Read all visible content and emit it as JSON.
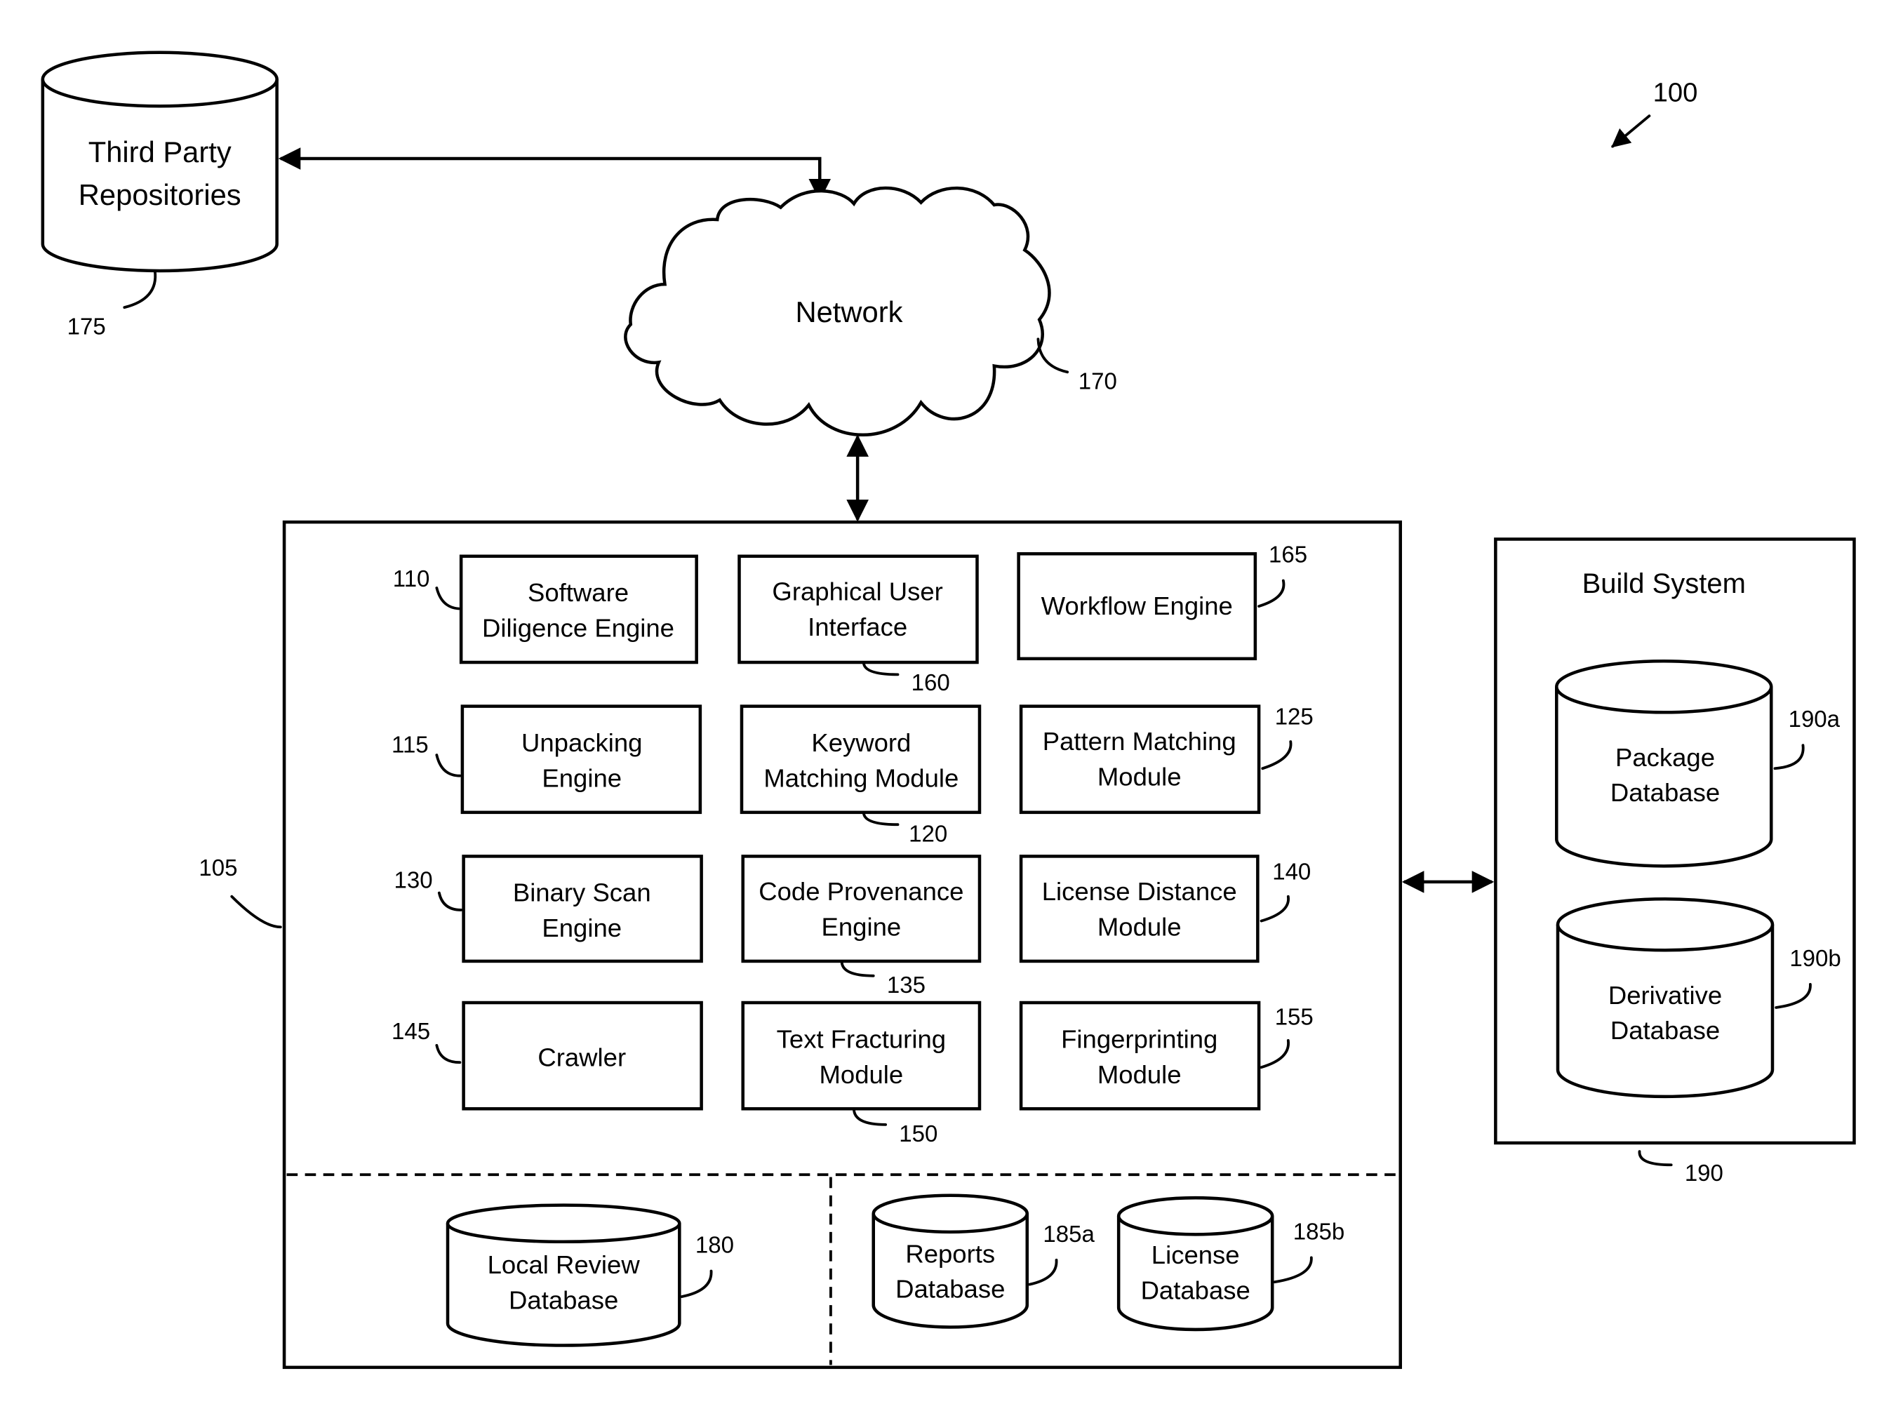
{
  "figure_ref": "100",
  "third_party": {
    "lines": [
      "Third Party",
      "Repositories"
    ],
    "ref": "175"
  },
  "network": {
    "label": "Network",
    "ref": "170"
  },
  "system": {
    "ref": "105",
    "modules": [
      {
        "lines": [
          "Software",
          "Diligence Engine"
        ],
        "ref": "110"
      },
      {
        "lines": [
          "Graphical User",
          "Interface"
        ],
        "ref": "160"
      },
      {
        "lines": [
          "Workflow Engine"
        ],
        "ref": "165"
      },
      {
        "lines": [
          "Unpacking",
          "Engine"
        ],
        "ref": "115"
      },
      {
        "lines": [
          "Keyword",
          "Matching Module"
        ],
        "ref": "120"
      },
      {
        "lines": [
          "Pattern Matching",
          "Module"
        ],
        "ref": "125"
      },
      {
        "lines": [
          "Binary Scan",
          "Engine"
        ],
        "ref": "130"
      },
      {
        "lines": [
          "Code Provenance",
          "Engine"
        ],
        "ref": "135"
      },
      {
        "lines": [
          "License Distance",
          "Module"
        ],
        "ref": "140"
      },
      {
        "lines": [
          "Crawler"
        ],
        "ref": "145"
      },
      {
        "lines": [
          "Text Fracturing",
          "Module"
        ],
        "ref": "150"
      },
      {
        "lines": [
          "Fingerprinting",
          "Module"
        ],
        "ref": "155"
      }
    ],
    "databases": [
      {
        "lines": [
          "Local Review",
          "Database"
        ],
        "ref": "180"
      },
      {
        "lines": [
          "Reports",
          "Database"
        ],
        "ref": "185a"
      },
      {
        "lines": [
          "License",
          "Database"
        ],
        "ref": "185b"
      }
    ]
  },
  "build_system": {
    "title": "Build System",
    "ref": "190",
    "databases": [
      {
        "lines": [
          "Package",
          "Database"
        ],
        "ref": "190a"
      },
      {
        "lines": [
          "Derivative",
          "Database"
        ],
        "ref": "190b"
      }
    ]
  }
}
